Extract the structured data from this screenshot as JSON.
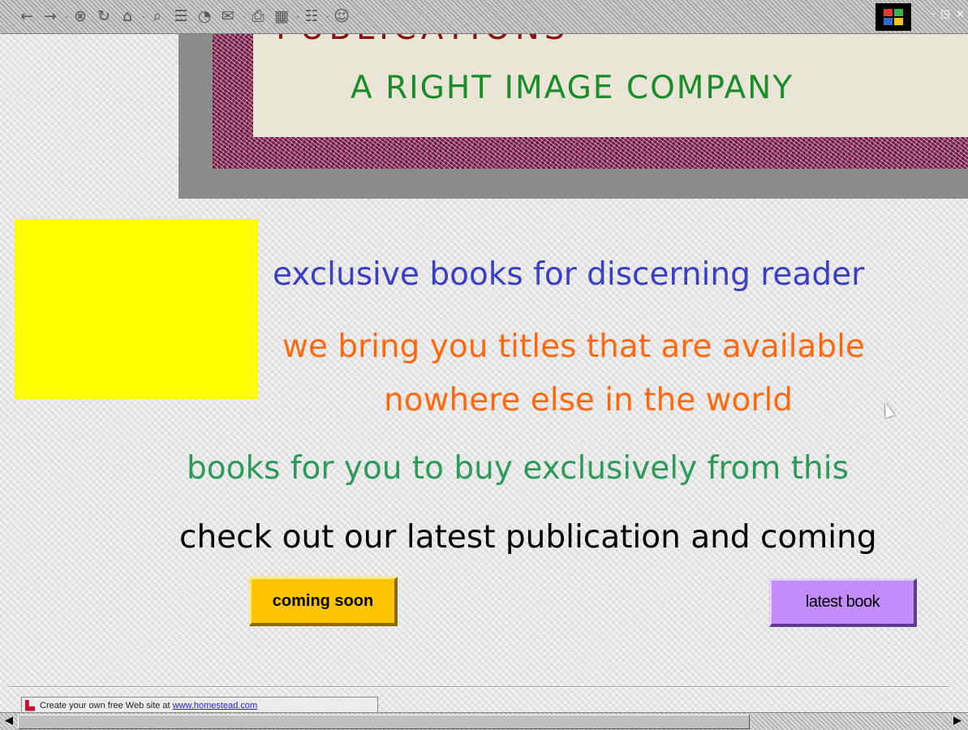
{
  "toolbar": {
    "buttons": [
      {
        "name": "back-icon",
        "glyph": "←"
      },
      {
        "name": "forward-icon",
        "glyph": "→"
      },
      {
        "name": "stop-icon",
        "glyph": "⊗"
      },
      {
        "name": "refresh-icon",
        "glyph": "↻"
      },
      {
        "name": "home-icon",
        "glyph": "⌂"
      },
      {
        "name": "search-icon",
        "glyph": "⌕"
      },
      {
        "name": "favorites-icon",
        "glyph": "☰"
      },
      {
        "name": "history-icon",
        "glyph": "◔"
      },
      {
        "name": "mail-icon",
        "glyph": "✉"
      },
      {
        "name": "print-icon",
        "glyph": "⎙"
      },
      {
        "name": "edit-icon",
        "glyph": "▦"
      },
      {
        "name": "discuss-icon",
        "glyph": "☷"
      },
      {
        "name": "messenger-icon",
        "glyph": "☺"
      }
    ],
    "window_controls": {
      "minimize": "–",
      "restore": "◳",
      "close": "×"
    }
  },
  "banner": {
    "title_partial": "PUBLICATIONS",
    "subtitle": "A RIGHT IMAGE COMPANY"
  },
  "taglines": {
    "line1": "exclusive books for discerning reader",
    "line2a": "we bring you titles that are available",
    "line2b": "nowhere else in the world",
    "line3": "books for you to buy exclusively from this",
    "line4": "check out our latest publication and coming"
  },
  "buttons": {
    "coming_soon": "coming soon",
    "latest_book": "latest book"
  },
  "footer": {
    "ad_text": "Create your own free Web site at",
    "ad_link": "www.homestead.com"
  },
  "colors": {
    "accent_yellow": "#ffff00",
    "tagline_blue": "#3a3fc4",
    "tagline_orange": "#ff6a10",
    "tagline_green": "#2e9a5a",
    "banner_green": "#1a8c28",
    "banner_border": "#7b1e4e",
    "coming_soon_bg": "#ffc400",
    "latest_book_bg": "#c28cff"
  }
}
